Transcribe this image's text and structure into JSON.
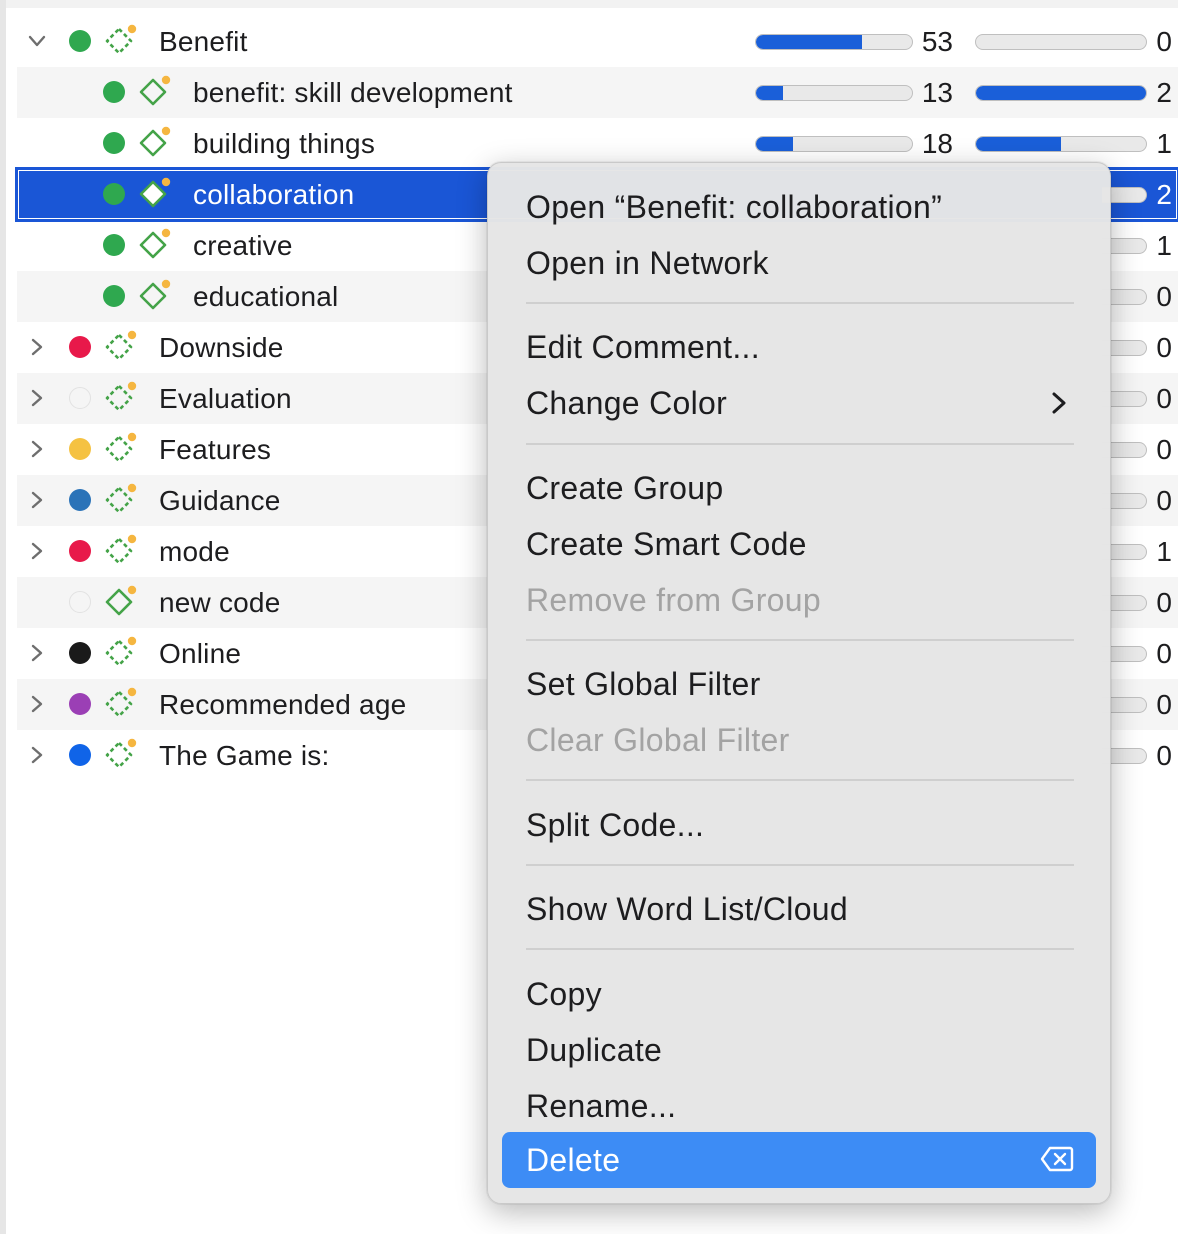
{
  "colors": {
    "accent_blue": "#1a56d6",
    "menu_highlight": "#3d8cf5",
    "green": "#2fa84f",
    "red": "#e8194a",
    "yellow": "#f5c242",
    "steel_blue": "#2b73b8",
    "black": "#1a1a1a",
    "purple": "#9b3fb5",
    "bright_blue": "#1064e8",
    "disabled_text": "#a3a3a3"
  },
  "outline": {
    "rows": [
      {
        "label": "Benefit",
        "chevron": "chevron-down-icon",
        "dot_color": "#2fa84f",
        "icon": "code-group-icon",
        "count1": "53",
        "bar1_fraction": 0.68,
        "count2": "0",
        "bar2_fraction": 0.0
      },
      {
        "label": "benefit: skill development",
        "chevron": "",
        "dot_color": "#2fa84f",
        "icon": "code-icon",
        "count1": "13",
        "bar1_fraction": 0.17,
        "count2": "2",
        "bar2_fraction": 1.0
      },
      {
        "label": "building things",
        "chevron": "",
        "dot_color": "#2fa84f",
        "icon": "code-icon",
        "count1": "18",
        "bar1_fraction": 0.24,
        "count2": "1",
        "bar2_fraction": 0.5
      },
      {
        "label": "collaboration",
        "chevron": "",
        "dot_color": "#2fa84f",
        "icon": "code-icon",
        "count2": "2",
        "selected": true
      },
      {
        "label": "creative",
        "chevron": "",
        "dot_color": "#2fa84f",
        "icon": "code-icon",
        "count2": "1"
      },
      {
        "label": "educational",
        "chevron": "",
        "dot_color": "#2fa84f",
        "icon": "code-icon",
        "count2": "0"
      },
      {
        "label": "Downside",
        "chevron": "chevron-right-icon",
        "dot_color": "#e8194a",
        "icon": "code-group-icon",
        "count2": "0"
      },
      {
        "label": "Evaluation",
        "chevron": "chevron-right-icon",
        "dot_color": "",
        "icon": "code-group-icon",
        "count2": "0"
      },
      {
        "label": "Features",
        "chevron": "chevron-right-icon",
        "dot_color": "#f5c242",
        "icon": "code-group-icon",
        "count2": "0"
      },
      {
        "label": "Guidance",
        "chevron": "chevron-right-icon",
        "dot_color": "#2b73b8",
        "icon": "code-group-icon",
        "count2": "0"
      },
      {
        "label": "mode",
        "chevron": "chevron-right-icon",
        "dot_color": "#e8194a",
        "icon": "code-group-icon",
        "count2": "1"
      },
      {
        "label": "new code",
        "chevron": "",
        "dot_color": "",
        "icon": "code-icon",
        "count2": "0"
      },
      {
        "label": "Online",
        "chevron": "chevron-right-icon",
        "dot_color": "#1a1a1a",
        "icon": "code-group-icon",
        "count2": "0"
      },
      {
        "label": "Recommended age",
        "chevron": "chevron-right-icon",
        "dot_color": "#9b3fb5",
        "icon": "code-group-icon",
        "count2": "0"
      },
      {
        "label": "The Game is:",
        "chevron": "chevron-right-icon",
        "dot_color": "#1064e8",
        "icon": "code-group-icon",
        "count2": "0"
      }
    ]
  },
  "context_menu": {
    "open": "Open “Benefit: collaboration”",
    "open_network": "Open in Network",
    "edit_comment": "Edit Comment...",
    "change_color": "Change Color",
    "create_group": "Create Group",
    "create_smart_code": "Create Smart Code",
    "remove_from_group": "Remove from Group",
    "set_global_filter": "Set Global Filter",
    "clear_global_filter": "Clear Global Filter",
    "split_code": "Split Code...",
    "show_word_list": "Show Word List/Cloud",
    "copy": "Copy",
    "duplicate": "Duplicate",
    "rename": "Rename...",
    "delete": "Delete"
  }
}
